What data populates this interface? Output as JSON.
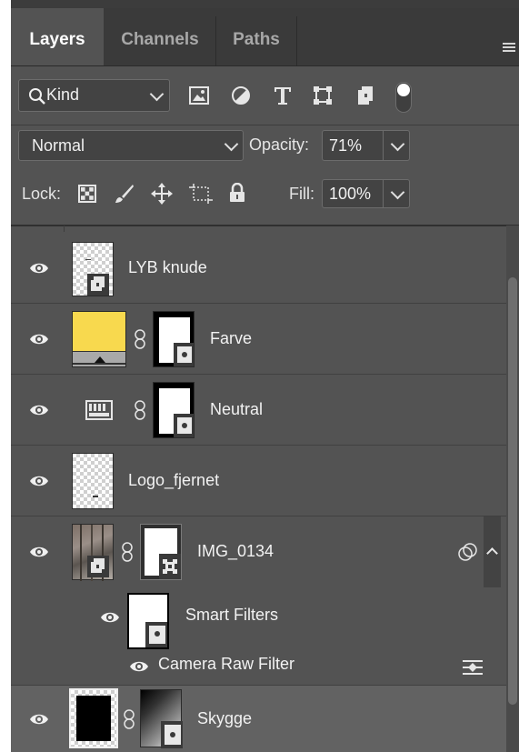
{
  "tabs": [
    {
      "label": "Layers",
      "active": true
    },
    {
      "label": "Channels",
      "active": false
    },
    {
      "label": "Paths",
      "active": false
    }
  ],
  "filter": {
    "kind_label": "Kind"
  },
  "blend": {
    "mode": "Normal",
    "opacity_label": "Opacity:",
    "opacity_value": "71%"
  },
  "lock": {
    "label": "Lock:",
    "fill_label": "Fill:",
    "fill_value": "100%"
  },
  "layers": [
    {
      "name": "LYB knude",
      "type": "smart-object"
    },
    {
      "name": "Farve",
      "type": "color-fill",
      "fill_color": "#f8d94e"
    },
    {
      "name": "Neutral",
      "type": "levels-adjustment"
    },
    {
      "name": "Logo_fjernet",
      "type": "pixel"
    },
    {
      "name": "IMG_0134",
      "type": "smart-object-filtered",
      "smart_filters": {
        "label": "Smart Filters",
        "filters": [
          {
            "name": "Camera Raw Filter"
          }
        ]
      }
    },
    {
      "name": "Skygge",
      "type": "pixel-masked",
      "selected": true
    }
  ],
  "colors": {
    "panel_bg": "#535353",
    "tab_bar_bg": "#3a3a3a",
    "selected_layer_bg": "#626262"
  }
}
